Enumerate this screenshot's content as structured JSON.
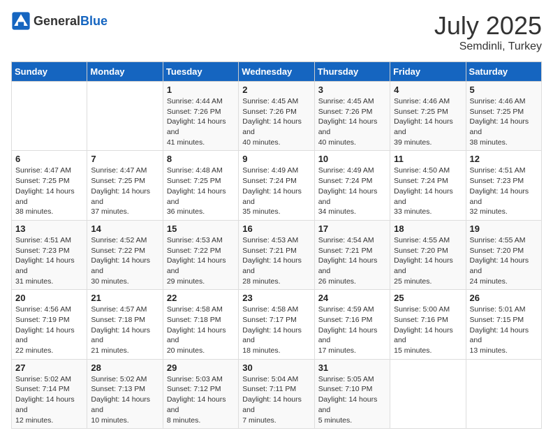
{
  "header": {
    "logo_general": "General",
    "logo_blue": "Blue",
    "month": "July 2025",
    "location": "Semdinli, Turkey"
  },
  "days_of_week": [
    "Sunday",
    "Monday",
    "Tuesday",
    "Wednesday",
    "Thursday",
    "Friday",
    "Saturday"
  ],
  "weeks": [
    [
      {
        "day": "",
        "sunrise": "",
        "sunset": "",
        "daylight": ""
      },
      {
        "day": "",
        "sunrise": "",
        "sunset": "",
        "daylight": ""
      },
      {
        "day": "1",
        "sunrise": "Sunrise: 4:44 AM",
        "sunset": "Sunset: 7:26 PM",
        "daylight": "Daylight: 14 hours and 41 minutes."
      },
      {
        "day": "2",
        "sunrise": "Sunrise: 4:45 AM",
        "sunset": "Sunset: 7:26 PM",
        "daylight": "Daylight: 14 hours and 40 minutes."
      },
      {
        "day": "3",
        "sunrise": "Sunrise: 4:45 AM",
        "sunset": "Sunset: 7:26 PM",
        "daylight": "Daylight: 14 hours and 40 minutes."
      },
      {
        "day": "4",
        "sunrise": "Sunrise: 4:46 AM",
        "sunset": "Sunset: 7:25 PM",
        "daylight": "Daylight: 14 hours and 39 minutes."
      },
      {
        "day": "5",
        "sunrise": "Sunrise: 4:46 AM",
        "sunset": "Sunset: 7:25 PM",
        "daylight": "Daylight: 14 hours and 38 minutes."
      }
    ],
    [
      {
        "day": "6",
        "sunrise": "Sunrise: 4:47 AM",
        "sunset": "Sunset: 7:25 PM",
        "daylight": "Daylight: 14 hours and 38 minutes."
      },
      {
        "day": "7",
        "sunrise": "Sunrise: 4:47 AM",
        "sunset": "Sunset: 7:25 PM",
        "daylight": "Daylight: 14 hours and 37 minutes."
      },
      {
        "day": "8",
        "sunrise": "Sunrise: 4:48 AM",
        "sunset": "Sunset: 7:25 PM",
        "daylight": "Daylight: 14 hours and 36 minutes."
      },
      {
        "day": "9",
        "sunrise": "Sunrise: 4:49 AM",
        "sunset": "Sunset: 7:24 PM",
        "daylight": "Daylight: 14 hours and 35 minutes."
      },
      {
        "day": "10",
        "sunrise": "Sunrise: 4:49 AM",
        "sunset": "Sunset: 7:24 PM",
        "daylight": "Daylight: 14 hours and 34 minutes."
      },
      {
        "day": "11",
        "sunrise": "Sunrise: 4:50 AM",
        "sunset": "Sunset: 7:24 PM",
        "daylight": "Daylight: 14 hours and 33 minutes."
      },
      {
        "day": "12",
        "sunrise": "Sunrise: 4:51 AM",
        "sunset": "Sunset: 7:23 PM",
        "daylight": "Daylight: 14 hours and 32 minutes."
      }
    ],
    [
      {
        "day": "13",
        "sunrise": "Sunrise: 4:51 AM",
        "sunset": "Sunset: 7:23 PM",
        "daylight": "Daylight: 14 hours and 31 minutes."
      },
      {
        "day": "14",
        "sunrise": "Sunrise: 4:52 AM",
        "sunset": "Sunset: 7:22 PM",
        "daylight": "Daylight: 14 hours and 30 minutes."
      },
      {
        "day": "15",
        "sunrise": "Sunrise: 4:53 AM",
        "sunset": "Sunset: 7:22 PM",
        "daylight": "Daylight: 14 hours and 29 minutes."
      },
      {
        "day": "16",
        "sunrise": "Sunrise: 4:53 AM",
        "sunset": "Sunset: 7:21 PM",
        "daylight": "Daylight: 14 hours and 28 minutes."
      },
      {
        "day": "17",
        "sunrise": "Sunrise: 4:54 AM",
        "sunset": "Sunset: 7:21 PM",
        "daylight": "Daylight: 14 hours and 26 minutes."
      },
      {
        "day": "18",
        "sunrise": "Sunrise: 4:55 AM",
        "sunset": "Sunset: 7:20 PM",
        "daylight": "Daylight: 14 hours and 25 minutes."
      },
      {
        "day": "19",
        "sunrise": "Sunrise: 4:55 AM",
        "sunset": "Sunset: 7:20 PM",
        "daylight": "Daylight: 14 hours and 24 minutes."
      }
    ],
    [
      {
        "day": "20",
        "sunrise": "Sunrise: 4:56 AM",
        "sunset": "Sunset: 7:19 PM",
        "daylight": "Daylight: 14 hours and 22 minutes."
      },
      {
        "day": "21",
        "sunrise": "Sunrise: 4:57 AM",
        "sunset": "Sunset: 7:18 PM",
        "daylight": "Daylight: 14 hours and 21 minutes."
      },
      {
        "day": "22",
        "sunrise": "Sunrise: 4:58 AM",
        "sunset": "Sunset: 7:18 PM",
        "daylight": "Daylight: 14 hours and 20 minutes."
      },
      {
        "day": "23",
        "sunrise": "Sunrise: 4:58 AM",
        "sunset": "Sunset: 7:17 PM",
        "daylight": "Daylight: 14 hours and 18 minutes."
      },
      {
        "day": "24",
        "sunrise": "Sunrise: 4:59 AM",
        "sunset": "Sunset: 7:16 PM",
        "daylight": "Daylight: 14 hours and 17 minutes."
      },
      {
        "day": "25",
        "sunrise": "Sunrise: 5:00 AM",
        "sunset": "Sunset: 7:16 PM",
        "daylight": "Daylight: 14 hours and 15 minutes."
      },
      {
        "day": "26",
        "sunrise": "Sunrise: 5:01 AM",
        "sunset": "Sunset: 7:15 PM",
        "daylight": "Daylight: 14 hours and 13 minutes."
      }
    ],
    [
      {
        "day": "27",
        "sunrise": "Sunrise: 5:02 AM",
        "sunset": "Sunset: 7:14 PM",
        "daylight": "Daylight: 14 hours and 12 minutes."
      },
      {
        "day": "28",
        "sunrise": "Sunrise: 5:02 AM",
        "sunset": "Sunset: 7:13 PM",
        "daylight": "Daylight: 14 hours and 10 minutes."
      },
      {
        "day": "29",
        "sunrise": "Sunrise: 5:03 AM",
        "sunset": "Sunset: 7:12 PM",
        "daylight": "Daylight: 14 hours and 8 minutes."
      },
      {
        "day": "30",
        "sunrise": "Sunrise: 5:04 AM",
        "sunset": "Sunset: 7:11 PM",
        "daylight": "Daylight: 14 hours and 7 minutes."
      },
      {
        "day": "31",
        "sunrise": "Sunrise: 5:05 AM",
        "sunset": "Sunset: 7:10 PM",
        "daylight": "Daylight: 14 hours and 5 minutes."
      },
      {
        "day": "",
        "sunrise": "",
        "sunset": "",
        "daylight": ""
      },
      {
        "day": "",
        "sunrise": "",
        "sunset": "",
        "daylight": ""
      }
    ]
  ]
}
